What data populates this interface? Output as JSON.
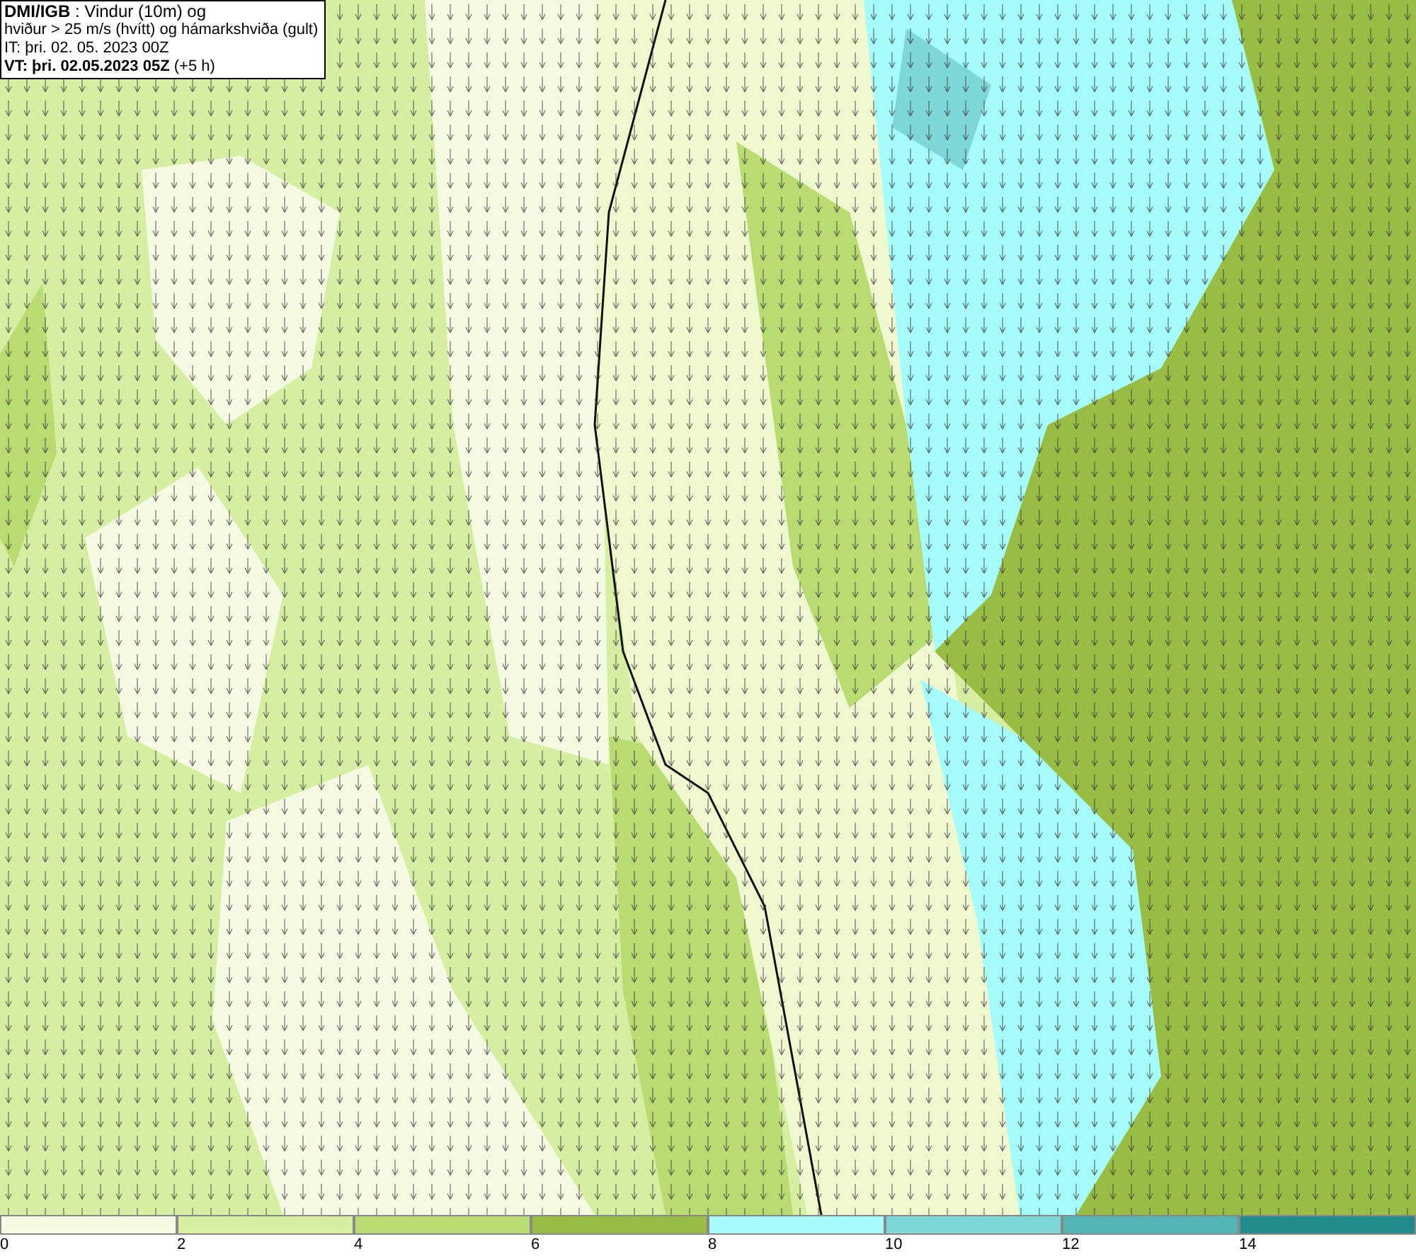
{
  "title_box": {
    "lines": [
      "**DMI/IGB** : Vindur (10m) og",
      "hviður > 25 m/s (hvítt) og hámarkshviða (gult)",
      "IT: þri. 02. 05. 2023 00Z",
      "**VT: þri. 02.05.2023 05Z** (+5 h)"
    ]
  },
  "legend": {
    "bins": [
      {
        "color": "#f5fbe3"
      },
      {
        "color": "#d6eea2"
      },
      {
        "color": "#b8dc72"
      },
      {
        "color": "#98bd45"
      },
      {
        "color": "#a6fbfb"
      },
      {
        "color": "#7fd6d6"
      },
      {
        "color": "#54b3b3"
      },
      {
        "color": "#228c8c"
      }
    ],
    "ticks": [
      "0",
      "2",
      "4",
      "6",
      "8",
      "10",
      "12",
      "14"
    ]
  }
}
